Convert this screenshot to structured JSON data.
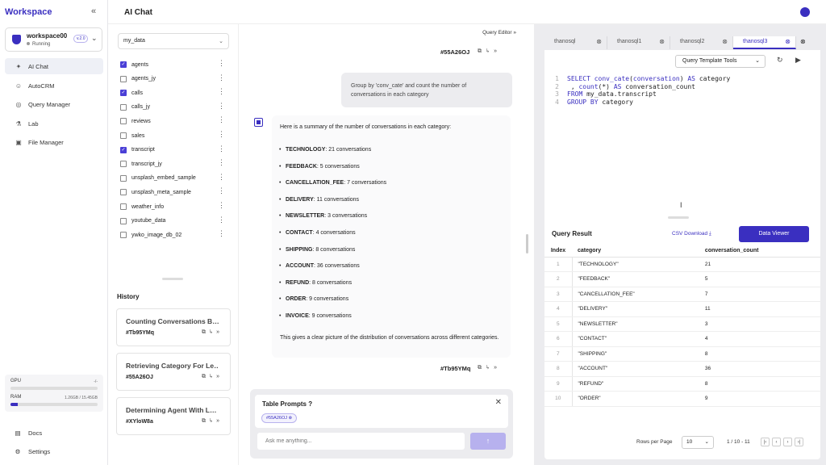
{
  "app": {
    "brand": "Workspace",
    "page_title": "AI Chat"
  },
  "workspace": {
    "name": "workspace00",
    "status": "Running",
    "version": "v.2.0"
  },
  "nav": [
    {
      "label": "AI Chat",
      "icon": "sparkle-icon",
      "active": true
    },
    {
      "label": "AutoCRM",
      "icon": "bot-icon",
      "active": false
    },
    {
      "label": "Query Manager",
      "icon": "database-icon",
      "active": false
    },
    {
      "label": "Lab",
      "icon": "flask-icon",
      "active": false
    },
    {
      "label": "File Manager",
      "icon": "folder-icon",
      "active": false
    }
  ],
  "resources": {
    "gpu": {
      "label": "GPU",
      "value": "-/-",
      "fraction": 0
    },
    "ram": {
      "label": "RAM",
      "value": "1.26GB / 15.45GB",
      "fraction": 0.08
    }
  },
  "footer_nav": [
    {
      "label": "Docs",
      "icon": "doc-icon"
    },
    {
      "label": "Settings",
      "icon": "gear-icon"
    }
  ],
  "database": {
    "selected": "my_data"
  },
  "tables": [
    {
      "name": "agents",
      "checked": true
    },
    {
      "name": "agents_jy",
      "checked": false
    },
    {
      "name": "calls",
      "checked": true
    },
    {
      "name": "calls_jy",
      "checked": false
    },
    {
      "name": "reviews",
      "checked": false
    },
    {
      "name": "sales",
      "checked": false
    },
    {
      "name": "transcript",
      "checked": true
    },
    {
      "name": "transcript_jy",
      "checked": false
    },
    {
      "name": "unsplash_embed_sample",
      "checked": false
    },
    {
      "name": "unsplash_meta_sample",
      "checked": false
    },
    {
      "name": "weather_info",
      "checked": false
    },
    {
      "name": "youtube_data",
      "checked": false
    },
    {
      "name": "ywko_image_db_02",
      "checked": false
    }
  ],
  "history": {
    "title": "History",
    "items": [
      {
        "title": "Counting Conversations B…",
        "id": "#Tb95YMq"
      },
      {
        "title": "Retrieving Category For Le…",
        "id": "#55A26OJ"
      },
      {
        "title": "Determining Agent With L…",
        "id": "#XYloW8a"
      }
    ]
  },
  "chat": {
    "query_editor_label": "Query Editor",
    "user_message": {
      "id": "#55A26OJ",
      "text": "Group by 'conv_cate' and count the number of conversations in each category"
    },
    "answer": {
      "id": "#Tb95YMq",
      "intro": "Here is a summary of the number of conversations in each category:",
      "items": [
        {
          "category": "TECHNOLOGY",
          "text": ": 21 conversations"
        },
        {
          "category": "FEEDBACK",
          "text": ": 5 conversations"
        },
        {
          "category": "CANCELLATION_FEE",
          "text": ": 7 conversations"
        },
        {
          "category": "DELIVERY",
          "text": ": 11 conversations"
        },
        {
          "category": "NEWSLETTER",
          "text": ": 3 conversations"
        },
        {
          "category": "CONTACT",
          "text": ": 4 conversations"
        },
        {
          "category": "SHIPPING",
          "text": ": 8 conversations"
        },
        {
          "category": "ACCOUNT",
          "text": ": 36 conversations"
        },
        {
          "category": "REFUND",
          "text": ": 8 conversations"
        },
        {
          "category": "ORDER",
          "text": ": 9 conversations"
        },
        {
          "category": "INVOICE",
          "text": ": 9 conversations"
        }
      ],
      "outro": "This gives a clear picture of the distribution of conversations across different categories."
    },
    "prompts": {
      "title": "Table Prompts",
      "chip": "#55A26OJ",
      "placeholder": "Ask me anything..."
    }
  },
  "editor": {
    "tabs": [
      {
        "label": "thanosql",
        "active": false
      },
      {
        "label": "thanosql1",
        "active": false
      },
      {
        "label": "thanosql2",
        "active": false
      },
      {
        "label": "thanosql3",
        "active": true
      }
    ],
    "tools_label": "Query Template Tools",
    "lines": [
      {
        "n": "1",
        "text": "SELECT conv_cate(conversation) AS category"
      },
      {
        "n": "2",
        "text": "     , count(*) AS conversation_count"
      },
      {
        "n": "3",
        "text": "FROM my_data.transcript"
      },
      {
        "n": "4",
        "text": "GROUP BY category"
      }
    ]
  },
  "result": {
    "title": "Query Result",
    "csv_label": "CSV Download",
    "viewer_label": "Data Viewer",
    "columns": [
      "Index",
      "category",
      "conversation_count"
    ],
    "rows": [
      [
        "1",
        "\"TECHNOLOGY\"",
        "21"
      ],
      [
        "2",
        "\"FEEDBACK\"",
        "5"
      ],
      [
        "3",
        "\"CANCELLATION_FEE\"",
        "7"
      ],
      [
        "4",
        "\"DELIVERY\"",
        "11"
      ],
      [
        "5",
        "\"NEWSLETTER\"",
        "3"
      ],
      [
        "6",
        "\"CONTACT\"",
        "4"
      ],
      [
        "7",
        "\"SHIPPING\"",
        "8"
      ],
      [
        "8",
        "\"ACCOUNT\"",
        "36"
      ],
      [
        "9",
        "\"REFUND\"",
        "8"
      ],
      [
        "10",
        "\"ORDER\"",
        "9"
      ]
    ],
    "rows_per_page_label": "Rows per Page",
    "rows_per_page": "10",
    "range": "1 / 10 - 11"
  },
  "colors": {
    "accent": "#3a2fc0"
  }
}
